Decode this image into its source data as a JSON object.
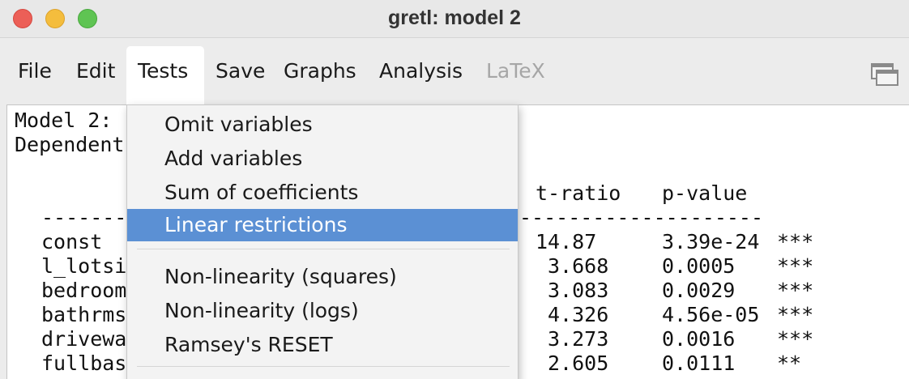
{
  "window": {
    "title": "gretl: model 2"
  },
  "menubar": {
    "items": [
      {
        "label": "File",
        "state": "normal"
      },
      {
        "label": "Edit",
        "state": "normal"
      },
      {
        "label": "Tests",
        "state": "open"
      },
      {
        "label": "Save",
        "state": "normal"
      },
      {
        "label": "Graphs",
        "state": "normal"
      },
      {
        "label": "Analysis",
        "state": "normal"
      },
      {
        "label": "LaTeX",
        "state": "disabled"
      }
    ]
  },
  "tests_menu": {
    "groups": [
      [
        "Omit variables",
        "Add variables",
        "Sum of coefficients",
        "Linear restrictions"
      ],
      [
        "Non-linearity (squares)",
        "Non-linearity (logs)",
        "Ramsey's RESET"
      ]
    ],
    "selected": "Linear restrictions"
  },
  "output": {
    "header_lines": [
      "Model 2:",
      "Dependent"
    ],
    "col_headers": {
      "t_ratio": "t-ratio",
      "p_value": "p-value"
    },
    "rule_left": "-------",
    "rule_right": "--------------------",
    "rows": [
      {
        "name": "const",
        "t_ratio": "14.87",
        "p_value": "3.39e-24",
        "stars": "***"
      },
      {
        "name": "l_lotsi",
        "t_ratio": "3.668",
        "p_value": "0.0005",
        "stars": "***"
      },
      {
        "name": "bedroom",
        "t_ratio": "3.083",
        "p_value": "0.0029",
        "stars": "***"
      },
      {
        "name": "bathrms",
        "t_ratio": "4.326",
        "p_value": "4.56e-05",
        "stars": "***"
      },
      {
        "name": "drivewa",
        "t_ratio": "3.273",
        "p_value": "0.0016",
        "stars": "***"
      },
      {
        "name": "fullbas",
        "t_ratio": "2.605",
        "p_value": "0.0111",
        "stars": "**"
      }
    ]
  },
  "icons": {
    "window_controls": "window-tile-icon"
  }
}
